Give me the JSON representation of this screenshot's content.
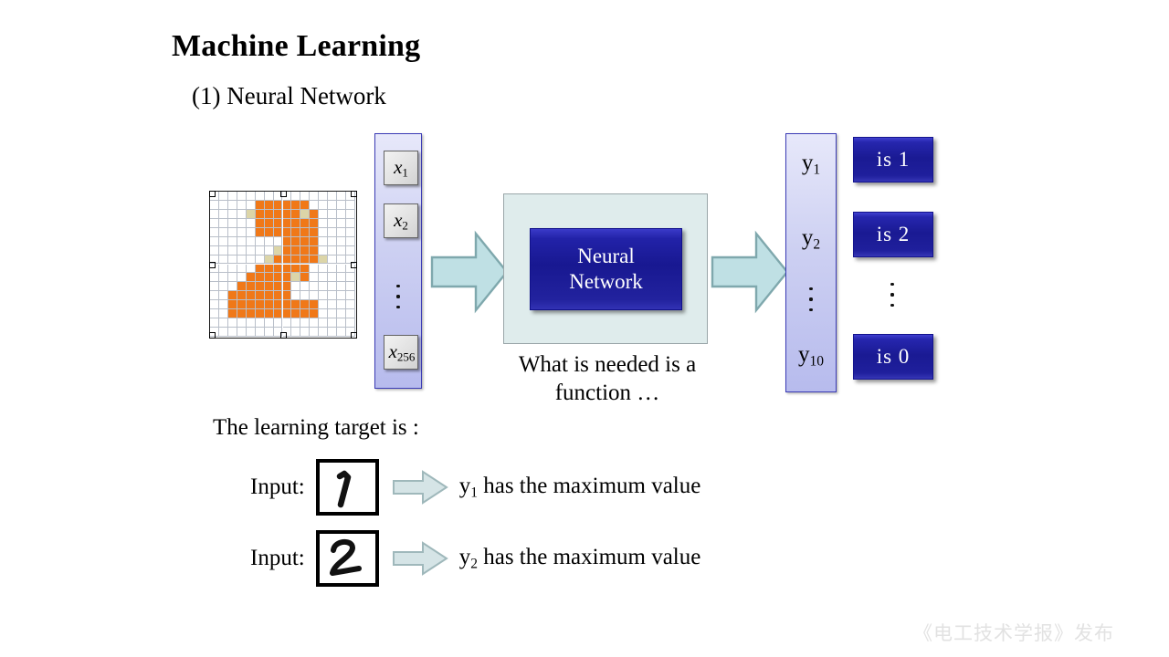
{
  "slide": {
    "title": "Machine Learning",
    "subtitle": "(1) Neural Network"
  },
  "input_vector": {
    "items": [
      {
        "label": "x",
        "sub": "1"
      },
      {
        "label": "x",
        "sub": "2"
      },
      {
        "label": "x",
        "sub": "256"
      }
    ],
    "ellipsis": "⋮"
  },
  "output_vector": {
    "items": [
      {
        "label": "y",
        "sub": "1"
      },
      {
        "label": "y",
        "sub": "2"
      },
      {
        "label": "y",
        "sub": "10"
      }
    ],
    "ellipsis": "⋮"
  },
  "network": {
    "line1": "Neural",
    "line2": "Network"
  },
  "class_buttons": [
    {
      "label": "is 1"
    },
    {
      "label": "is 2"
    },
    {
      "label": "is 0"
    }
  ],
  "captions": {
    "function_line1": "What is needed is a",
    "function_line2": "function …",
    "learning_target": "The learning target is :"
  },
  "examples": [
    {
      "input_label": "Input:",
      "digit": "1",
      "result_prefix": "y",
      "result_sub": "1",
      "result_suffix": " has the maximum value"
    },
    {
      "input_label": "Input:",
      "digit": "2",
      "result_prefix": "y",
      "result_sub": "2",
      "result_suffix": " has the maximum value"
    }
  ],
  "watermark": {
    "text": "《电工技术学报》发布"
  },
  "colors": {
    "digit_fill": "#f07818",
    "digit_fill_light": "#dcd5a8",
    "arrow_fill": "#bfe0e4",
    "arrow_stroke": "#7fa8ad",
    "small_arrow_fill": "#d5e4e6",
    "small_arrow_stroke": "#9fb8bb",
    "vector_border": "#3b3bb5",
    "button_blue": "#1a1a93",
    "panel_bg": "#dfecec",
    "watermark": "#e2e2e2"
  },
  "digit_bitmap": {
    "size": 16,
    "rows": [
      "0000000000000000",
      "0000011111100000",
      "0000211111210000",
      "0000011111110000",
      "0000011111110000",
      "0000000011110000",
      "0000000211110000",
      "0000002111112000",
      "0000011111100000",
      "0000111112100000",
      "0001111110000000",
      "0011111110000000",
      "0011111111110000",
      "0011111111110000",
      "0000000000000000",
      "0000000000000000"
    ]
  }
}
